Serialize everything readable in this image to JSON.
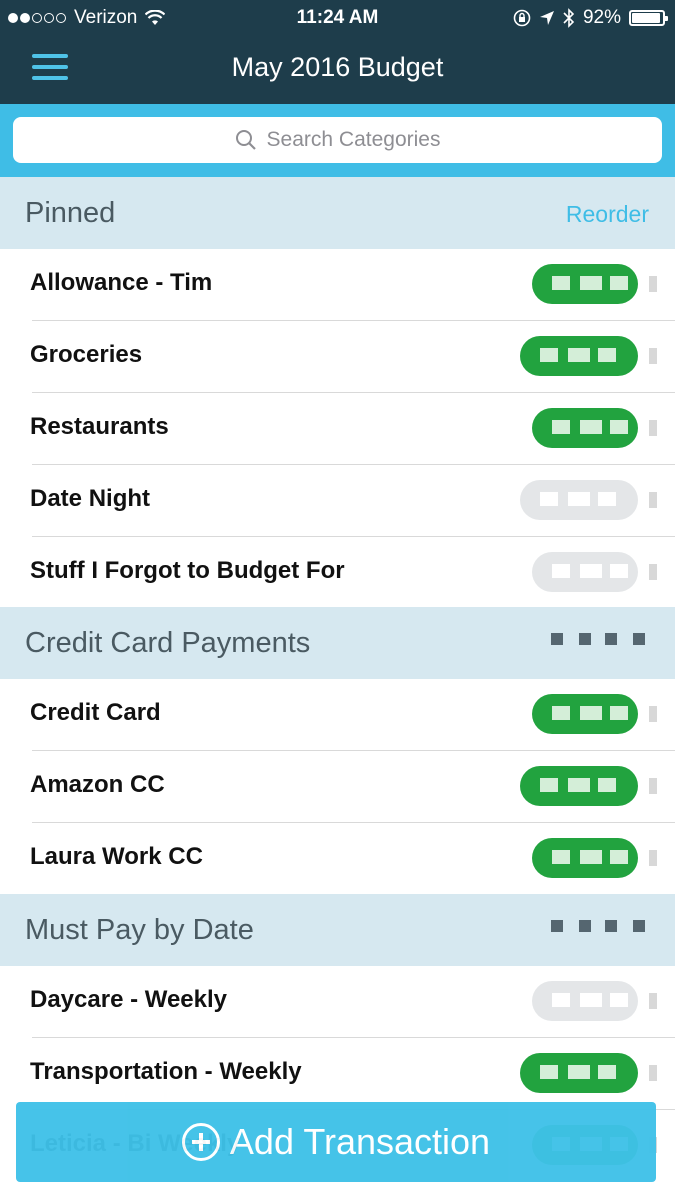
{
  "status_bar": {
    "carrier": "Verizon",
    "time": "11:24 AM",
    "battery_percent": "92%",
    "battery_level": 0.92,
    "signal_bars_filled": 2,
    "signal_bars_total": 5,
    "icons": [
      "wifi-icon",
      "rotation-lock-icon",
      "location-icon",
      "bluetooth-icon",
      "battery-icon"
    ]
  },
  "nav": {
    "title": "May 2016 Budget",
    "menu_icon": "hamburger-icon"
  },
  "search": {
    "placeholder": "Search Categories",
    "icon": "search-icon"
  },
  "sections": {
    "pinned": {
      "title": "Pinned",
      "action": "Reorder",
      "rows": [
        {
          "label": "Allowance - Tim",
          "status": "green"
        },
        {
          "label": "Groceries",
          "status": "green"
        },
        {
          "label": "Restaurants",
          "status": "green"
        },
        {
          "label": "Date Night",
          "status": "grey"
        },
        {
          "label": "Stuff I Forgot to Budget For",
          "status": "grey"
        }
      ]
    },
    "credit": {
      "title": "Credit Card Payments",
      "rows": [
        {
          "label": "Credit Card",
          "status": "green"
        },
        {
          "label": "Amazon CC",
          "status": "green"
        },
        {
          "label": "Laura Work  CC",
          "status": "green"
        }
      ]
    },
    "must_pay": {
      "title": "Must Pay by Date",
      "rows": [
        {
          "label": "Daycare - Weekly",
          "status": "grey"
        },
        {
          "label": "Transportation - Weekly",
          "status": "green"
        },
        {
          "label": "Leticia - Bi Weekly",
          "status": "green"
        }
      ]
    }
  },
  "add_transaction": {
    "label": "Add Transaction",
    "icon": "plus-circle-icon"
  },
  "colors": {
    "nav_background": "#1e3d4b",
    "accent": "#3fbde6",
    "section_background": "#d6e8f0",
    "positive_pill": "#22a33f",
    "neutral_pill": "#e4e6e8"
  }
}
